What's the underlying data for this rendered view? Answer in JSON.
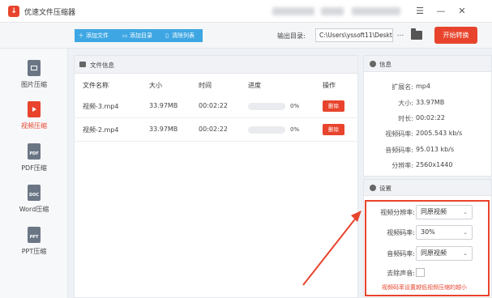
{
  "app": {
    "title": "优速文件压缩器",
    "logo": "logo-icon"
  },
  "window_controls": [
    "menu-icon",
    "minimize-icon",
    "close-icon"
  ],
  "toolbar": {
    "add_file": "添加文件",
    "add_folder": "添加目录",
    "clear_list": "清除列表",
    "output_label": "输出目录:",
    "output_path": "C:\\Users\\yssoft11\\Deskt",
    "more_label": "...",
    "start_label": "开始转换"
  },
  "sidebar": {
    "items": [
      {
        "label": "图片压缩",
        "icon": "image-file-icon",
        "icon_text": "",
        "active": false
      },
      {
        "label": "视频压缩",
        "icon": "video-file-icon",
        "icon_text": "",
        "active": true
      },
      {
        "label": "PDF压缩",
        "icon": "pdf-file-icon",
        "icon_text": "PDF",
        "active": false
      },
      {
        "label": "Word压缩",
        "icon": "doc-file-icon",
        "icon_text": "DOC",
        "active": false
      },
      {
        "label": "PPT压缩",
        "icon": "ppt-file-icon",
        "icon_text": "PPT",
        "active": false
      }
    ]
  },
  "file_panel": {
    "title": "文件信息",
    "columns": [
      "文件名称",
      "大小",
      "时间",
      "进度",
      "操作"
    ],
    "rows": [
      {
        "name": "视频-3.mp4",
        "size": "33.97MB",
        "time": "00:02:22",
        "progress": "0%",
        "progress_value": 0,
        "action": "删除"
      },
      {
        "name": "视频-2.mp4",
        "size": "33.97MB",
        "time": "00:02:22",
        "progress": "0%",
        "progress_value": 0,
        "action": "删除"
      }
    ]
  },
  "info_panel": {
    "title": "信息",
    "rows": [
      {
        "key": "扩展名:",
        "value": "mp4"
      },
      {
        "key": "大小:",
        "value": "33.97MB"
      },
      {
        "key": "时长:",
        "value": "00:02:22"
      },
      {
        "key": "视频码率:",
        "value": "2005.543 kb/s"
      },
      {
        "key": "音频码率:",
        "value": "95.013 kb/s"
      },
      {
        "key": "分辨率:",
        "value": "2560x1440"
      }
    ]
  },
  "settings_panel": {
    "title": "设置",
    "resolution_label": "视频分辨率:",
    "resolution_value": "同原视频",
    "video_bitrate_label": "视频码率:",
    "video_bitrate_value": "30%",
    "audio_bitrate_label": "音频码率:",
    "audio_bitrate_value": "同原视频",
    "remove_audio_label": "去除声音:",
    "remove_audio_checked": false,
    "tip": "视频码率设置越低视频压缩的越小"
  },
  "colors": {
    "accent": "#e8442d",
    "toolbar_button": "#3ea7e3",
    "sidebar_icon": "#6b7685"
  }
}
